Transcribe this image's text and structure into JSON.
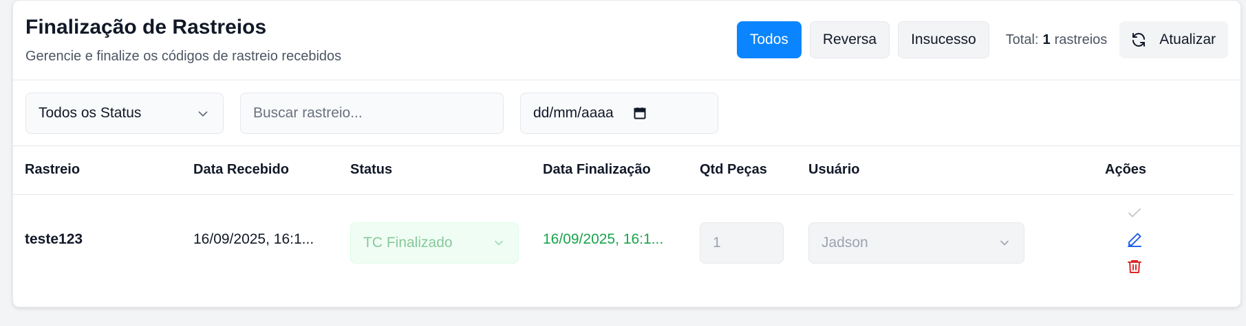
{
  "header": {
    "title": "Finalização de Rastreios",
    "subtitle": "Gerencie e finalize os códigos de rastreio recebidos",
    "filter_buttons": [
      "Todos",
      "Reversa",
      "Insucesso"
    ],
    "total_prefix": "Total:",
    "total_count": "1",
    "total_suffix": "rastreios",
    "refresh_label": "Atualizar"
  },
  "filters": {
    "status_value": "Todos os Status",
    "search_placeholder": "Buscar rastreio...",
    "date_placeholder": "dd/mm/aaaa"
  },
  "table": {
    "columns": [
      "Rastreio",
      "Data Recebido",
      "Status",
      "Data Finalização",
      "Qtd Peças",
      "Usuário",
      "Ações"
    ],
    "rows": [
      {
        "rastreio": "teste123",
        "data_recebido": "16/09/2025, 16:1...",
        "status": "TC Finalizado",
        "data_finalizacao": "16/09/2025, 16:1...",
        "qtd_pecas": "1",
        "usuario": "Jadson"
      }
    ]
  },
  "colors": {
    "accent": "#0a84ff",
    "success_text": "#16a34a",
    "danger": "#dc2626",
    "edit": "#2563eb"
  },
  "icons": [
    "chevron-down-icon",
    "calendar-icon",
    "refresh-icon",
    "check-icon",
    "edit-icon",
    "trash-icon"
  ]
}
